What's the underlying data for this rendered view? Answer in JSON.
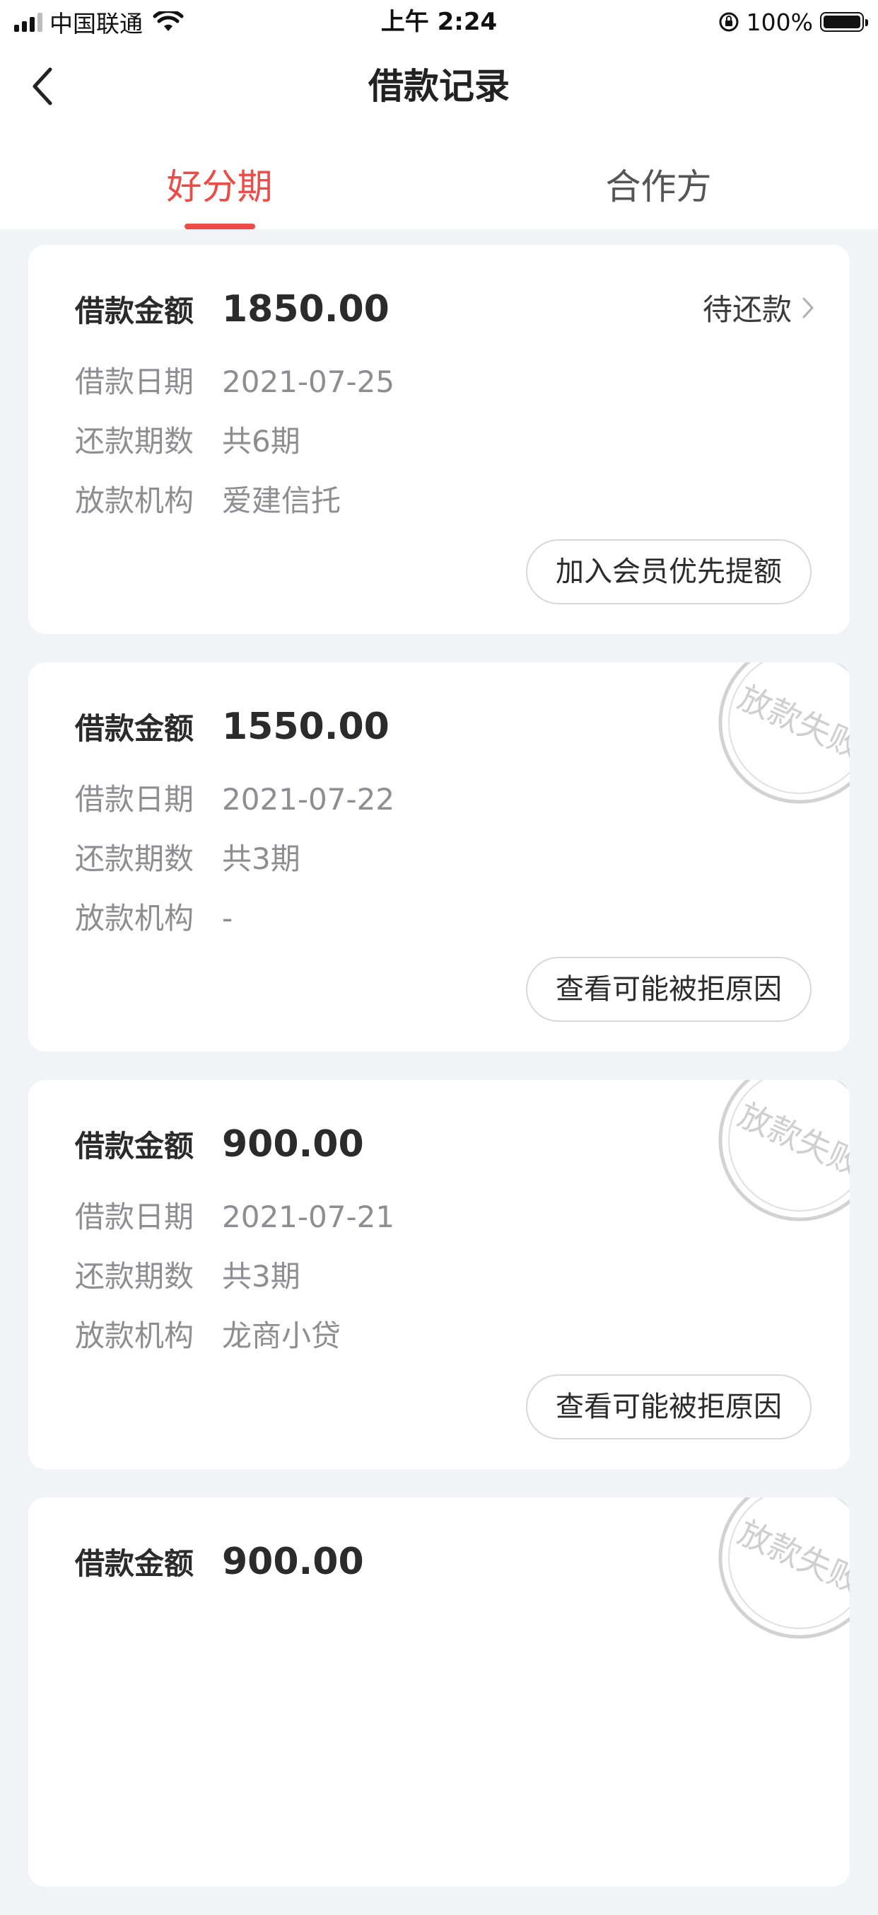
{
  "status_bar": {
    "carrier": "中国联通",
    "time": "上午 2:24",
    "battery": "100%"
  },
  "nav": {
    "title": "借款记录"
  },
  "tabs": [
    {
      "label": "好分期",
      "active": true
    },
    {
      "label": "合作方",
      "active": false
    }
  ],
  "labels": {
    "amount": "借款金额",
    "date": "借款日期",
    "periods": "还款期数",
    "lender": "放款机构"
  },
  "records": [
    {
      "amount": "1850.00",
      "date": "2021-07-25",
      "periods": "共6期",
      "lender": "爱建信托",
      "status": "待还款",
      "action": "加入会员优先提额",
      "stamp": ""
    },
    {
      "amount": "1550.00",
      "date": "2021-07-22",
      "periods": "共3期",
      "lender": "-",
      "status": "",
      "action": "查看可能被拒原因",
      "stamp": "放款失败"
    },
    {
      "amount": "900.00",
      "date": "2021-07-21",
      "periods": "共3期",
      "lender": "龙商小贷",
      "status": "",
      "action": "查看可能被拒原因",
      "stamp": "放款失败"
    },
    {
      "amount": "900.00",
      "date": "",
      "periods": "",
      "lender": "",
      "status": "",
      "action": "",
      "stamp": "放款失败"
    }
  ],
  "colors": {
    "accent": "#ec4b47",
    "background": "#f2f3f7",
    "muted_text": "#8d8d92",
    "stamp": "#c8c8c8"
  }
}
